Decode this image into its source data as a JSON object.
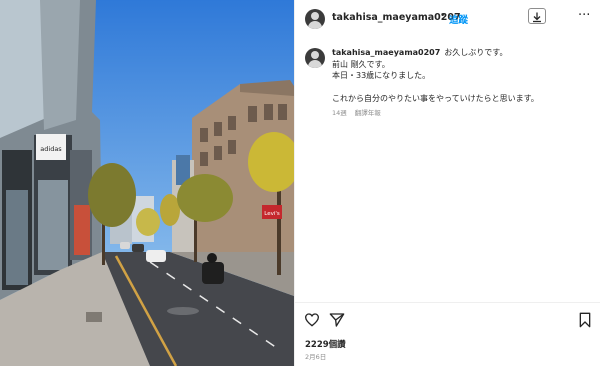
{
  "post": {
    "username": "takahisa_maeyama0207",
    "dot": "•",
    "follow_label": "追蹤",
    "more_label": "···",
    "caption": {
      "username": "takahisa_maeyama0207",
      "text": "お久しぶりです。\n前山 剛久です。\n本日・33歳になりました。\n\nこれから自分のやりたい事をやっていけたらと思います。",
      "time": "14週",
      "translate_label": "翻譯年報"
    },
    "likes": "2229個讚",
    "date": "2月6日"
  },
  "photo": {
    "store_signs": [
      "adidas",
      "Levi's"
    ],
    "sky_color": "#8ec2ef",
    "road_color": "#45474c"
  },
  "icons": {
    "heart": "heart-icon",
    "share": "paper-plane-icon",
    "save": "bookmark-icon",
    "download": "download-icon",
    "more": "more-options-icon"
  }
}
